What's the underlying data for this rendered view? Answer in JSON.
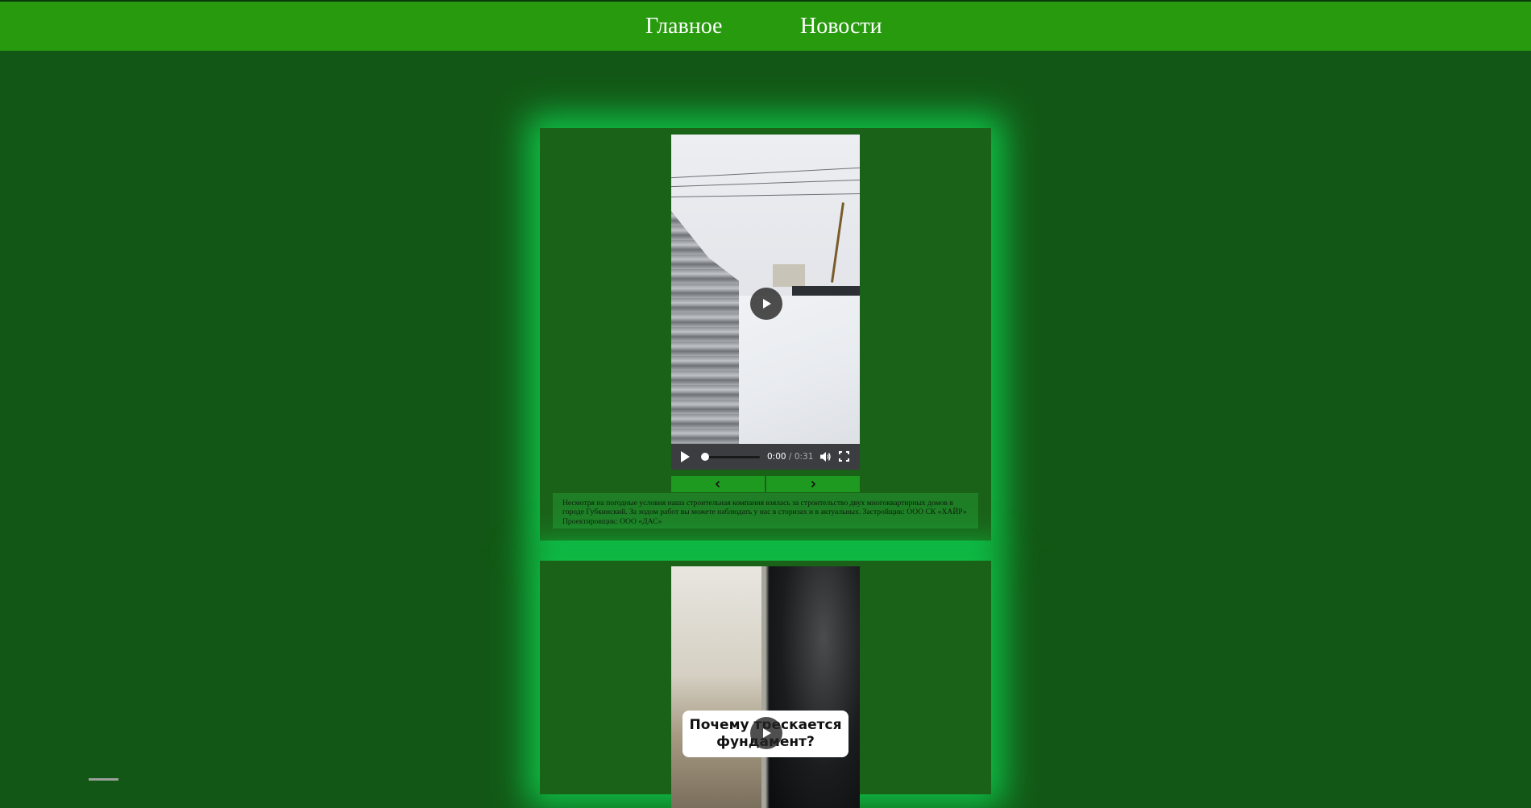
{
  "nav": {
    "home_label": "Главное",
    "news_label": "Новости"
  },
  "posts": [
    {
      "video": {
        "current_time": "0:00",
        "separator": " / ",
        "duration": "0:31",
        "progress": 0.0
      },
      "caption": "Несмотря на погодные условия наша строительная компания взялась за строительство двух многоквартирных домов в городе Губкинский. За ходом работ вы можете наблюдать у нас в сторизах и в актуальных. Застройщик: ООО СК «ХАЙР» Проектировщик: ООО «ДАС»"
    },
    {
      "video": {
        "overlay_text": "Почему трескается\nфундамент?"
      }
    }
  ],
  "icons": {
    "play": "play-icon",
    "volume": "volume-icon",
    "fullscreen": "fullscreen-icon",
    "prev": "chevron-left-icon",
    "next": "chevron-right-icon"
  },
  "colors": {
    "page_background": "#135716",
    "header_background": "#289a0e",
    "card_background": "#1a6218",
    "card_glow": "#0de65a",
    "arrow_button": "#1e9a21",
    "caption_background": "#1f7e26"
  }
}
